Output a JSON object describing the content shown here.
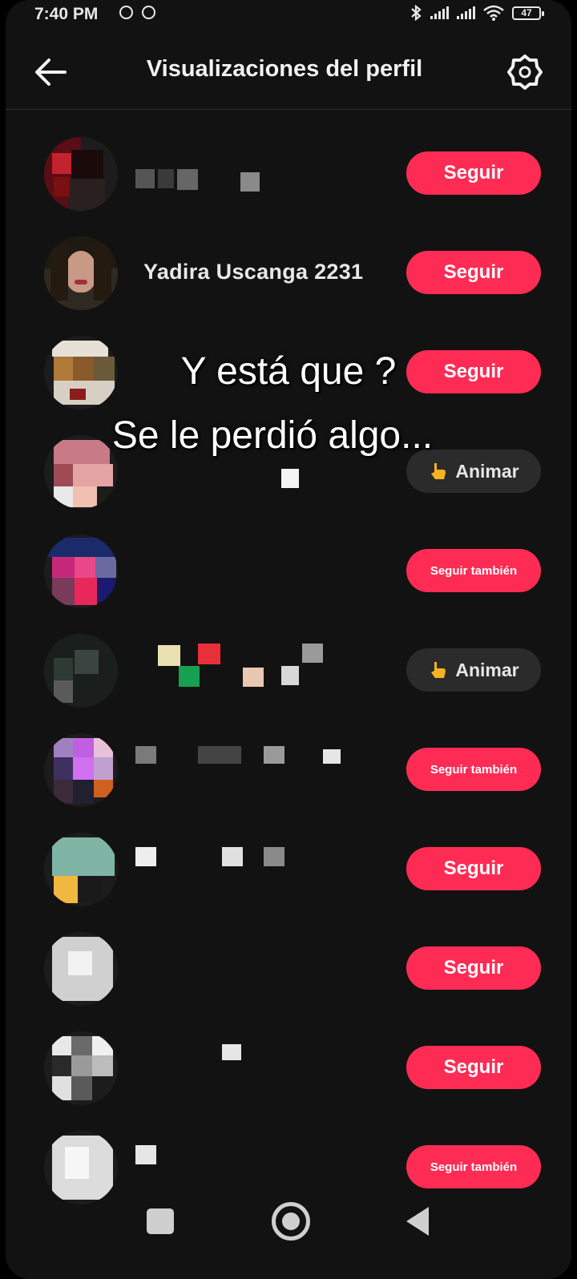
{
  "status_bar": {
    "time": "7:40 PM",
    "battery": "47"
  },
  "header": {
    "title": "Visualizaciones del perfil"
  },
  "overlay": {
    "line1": "Y está que ?",
    "line2": "Se le perdió algo..."
  },
  "rows": [
    {
      "username": "",
      "button": "Seguir"
    },
    {
      "username": "Yadira Uscanga 2231",
      "button": "Seguir"
    },
    {
      "username": "",
      "button": "Seguir"
    },
    {
      "username": "",
      "button": "Animar"
    },
    {
      "username": "",
      "button": "Seguir también"
    },
    {
      "username": "",
      "button": "Animar"
    },
    {
      "username": "",
      "button": "Seguir también"
    },
    {
      "username": "",
      "button": "Seguir"
    },
    {
      "username": "",
      "button": "Seguir"
    },
    {
      "username": "",
      "button": "Seguir"
    },
    {
      "username": "",
      "button": "Seguir también"
    }
  ],
  "colors": {
    "accent": "#fe2c55",
    "background": "#121212",
    "secondary_button": "#2b2b2b"
  },
  "icons": [
    "back-arrow-icon",
    "gear-icon",
    "bluetooth-icon",
    "signal-icon",
    "wifi-icon",
    "battery-icon",
    "whatsapp-icon",
    "hand-pointing-icon"
  ]
}
